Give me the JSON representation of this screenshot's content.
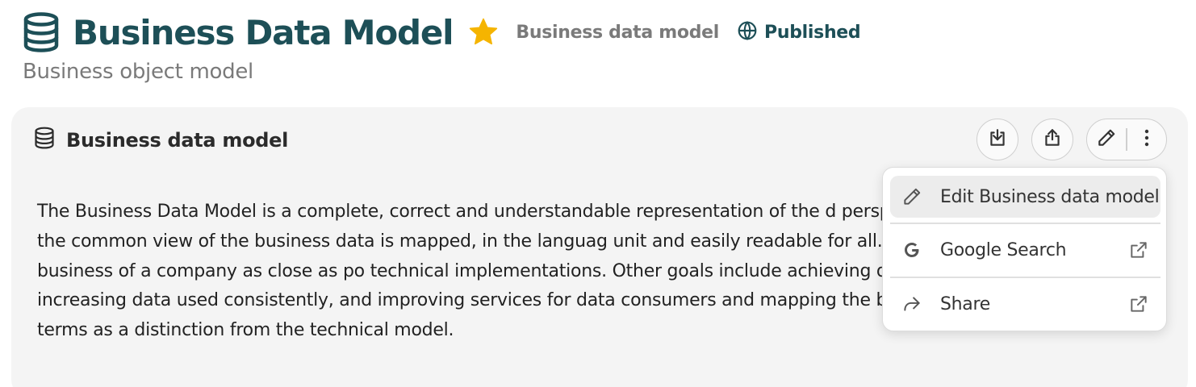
{
  "header": {
    "title": "Business Data Model",
    "type_label": "Business data model",
    "status": "Published",
    "subtitle": "Business object model"
  },
  "card": {
    "title": "Business data model",
    "description": "The Business Data Model is a complete, correct and understandable representation of the d perspective. In this model, the common view of the business data is mapped, in the languag unit and easily readable for all. The goal is to map the business of a company as close as po technical implementations. Other goals include achieving data uniqueness, increasing data used consistently, and improving services for data consumers and mapping the business in business terms as a distinction from the technical model."
  },
  "actions": {
    "download": "download-icon",
    "upload": "upload-icon",
    "edit": "pencil-icon",
    "more": "more-vertical-icon"
  },
  "menu": {
    "items": [
      {
        "label": "Edit Business data model",
        "icon": "pencil-icon",
        "external": false
      },
      {
        "label": "Google Search",
        "icon": "google-icon",
        "external": true
      },
      {
        "label": "Share",
        "icon": "share-icon",
        "external": true
      }
    ]
  },
  "colors": {
    "brand": "#1d4f57",
    "star": "#f5b400",
    "muted": "#7a7a7a",
    "card_bg": "#f4f4f4"
  }
}
